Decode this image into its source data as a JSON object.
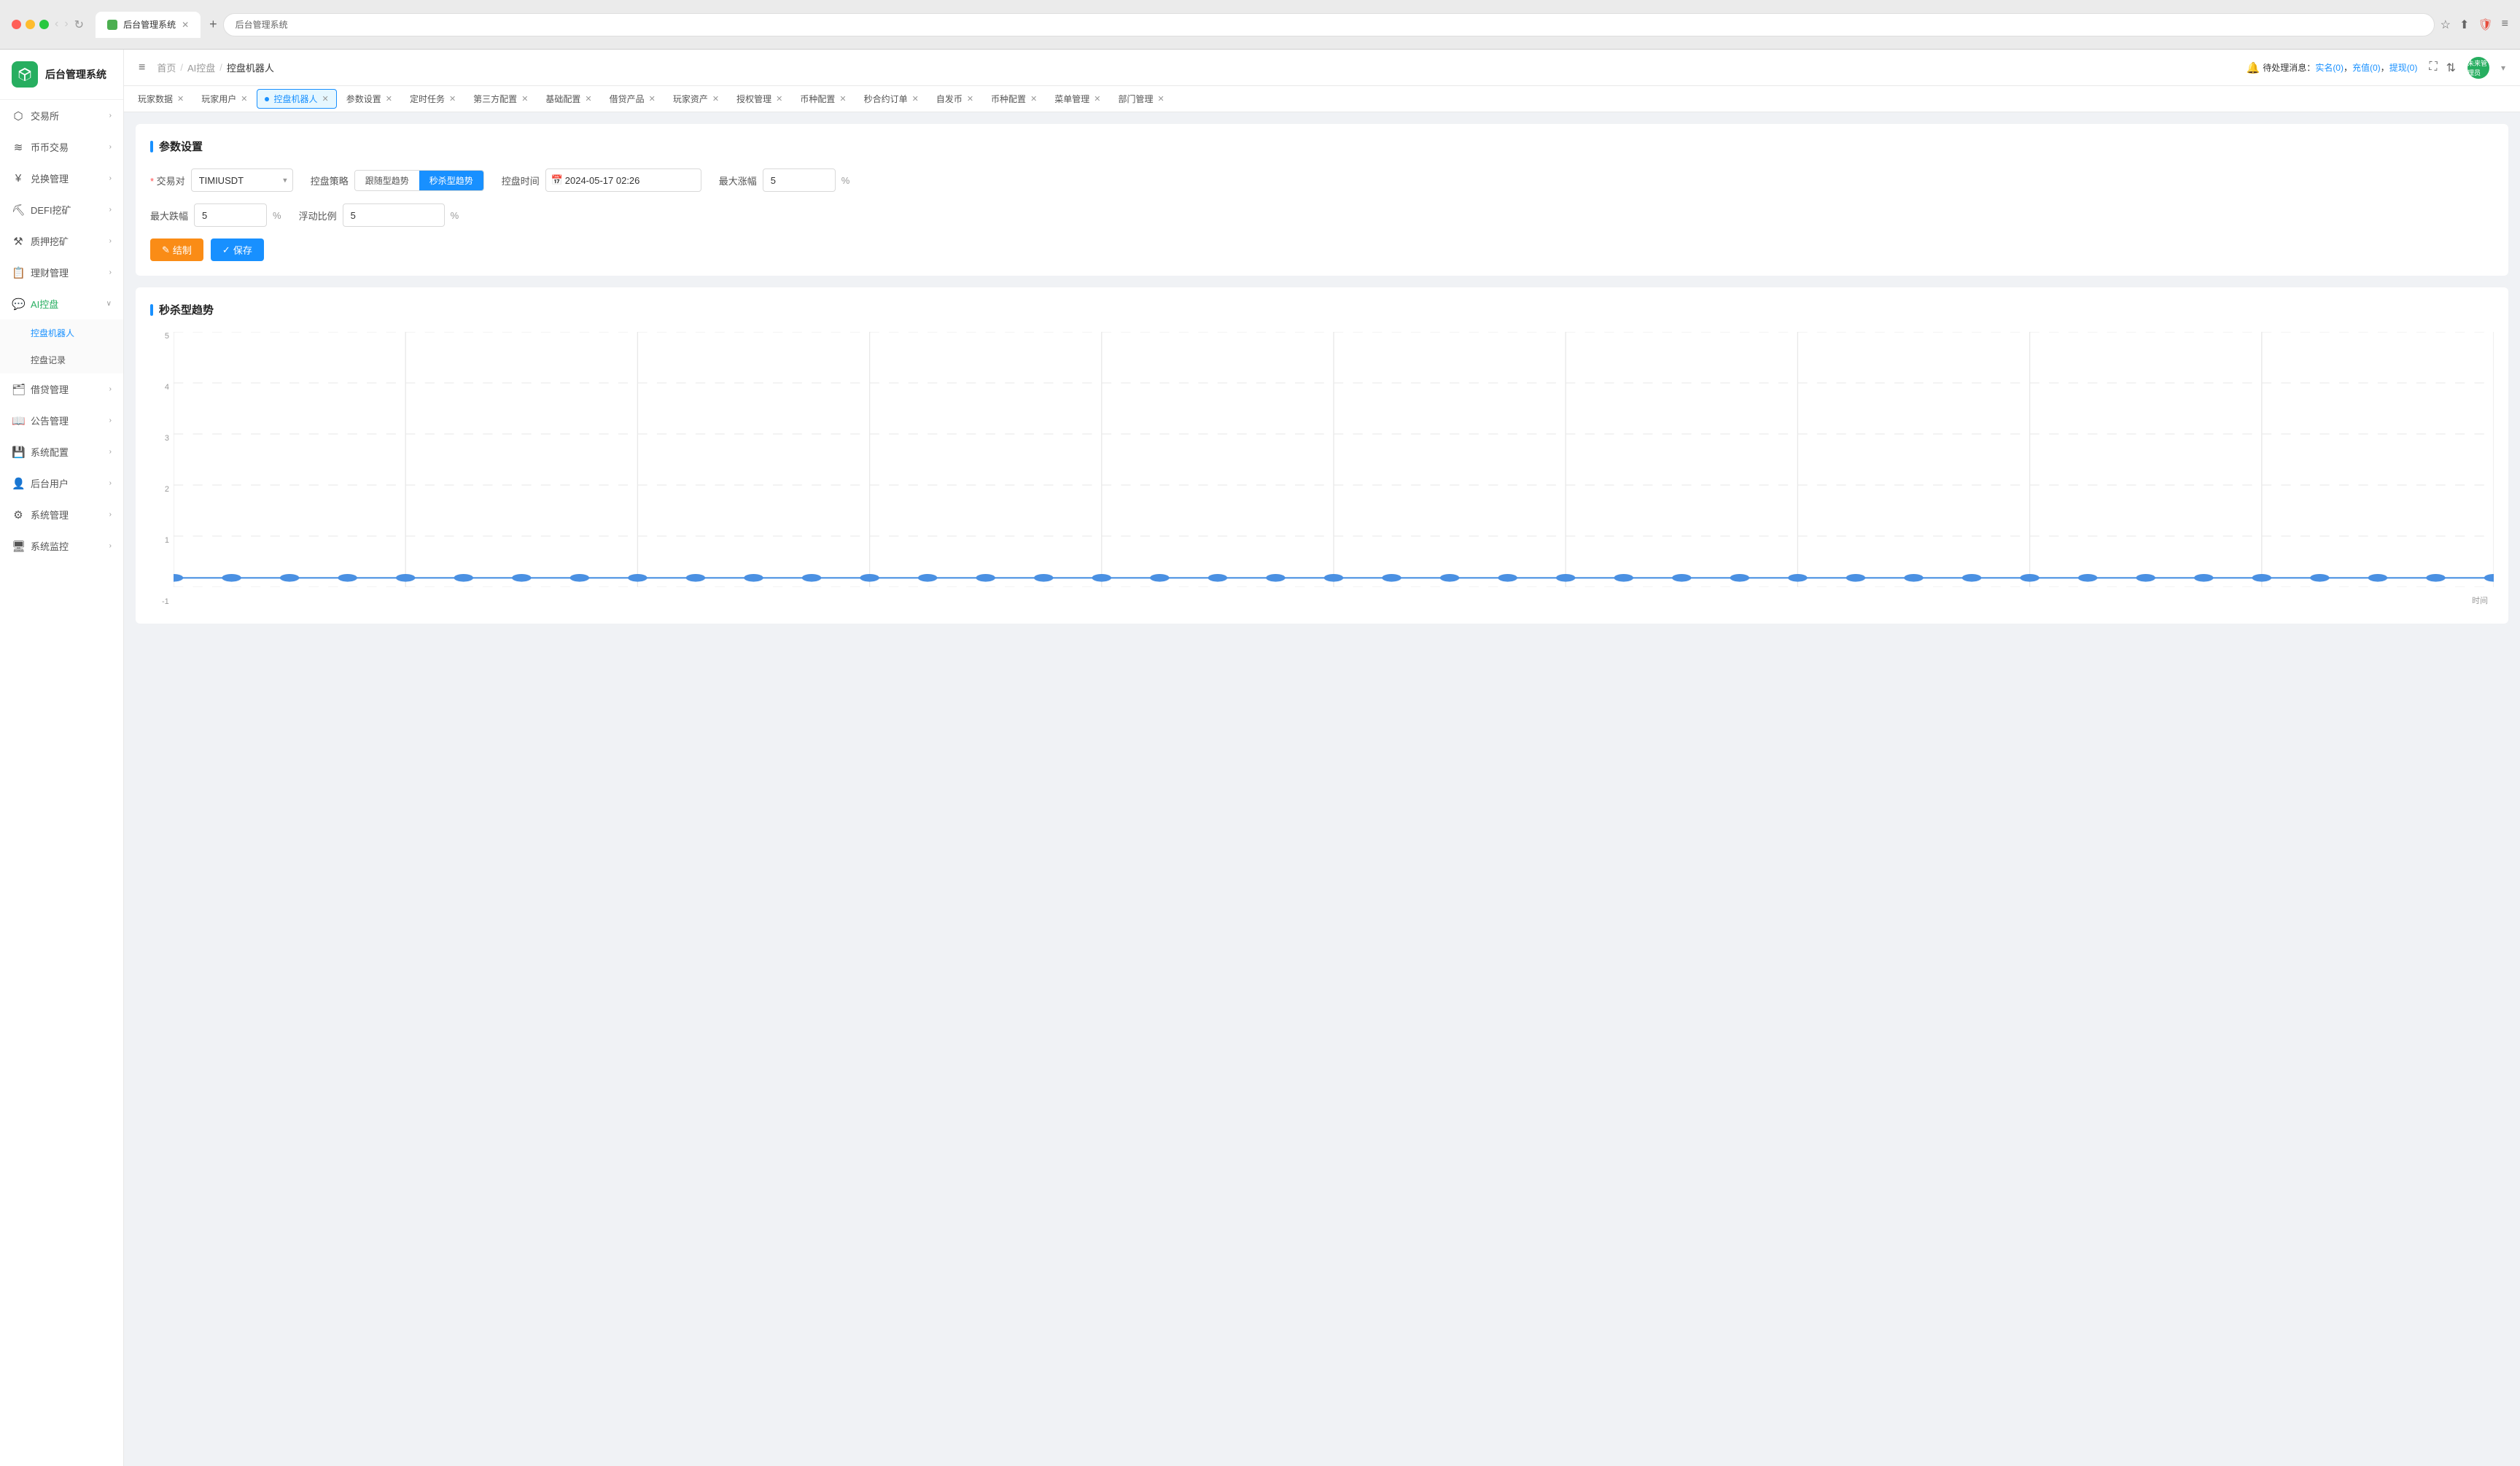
{
  "browser": {
    "tab_title": "后台管理系统",
    "url": "后台管理系统",
    "new_tab_label": "+"
  },
  "header": {
    "menu_toggle": "≡",
    "breadcrumbs": [
      "首页",
      "AI控盘",
      "控盘机器人"
    ],
    "notification": "待处理消息：实名(0)，充值(0)，提现(0)",
    "notification_realname": "实名(0)",
    "notification_recharge": "充值(0)",
    "notification_withdraw": "提现(0)",
    "user_label": "未来管理员"
  },
  "tabs": [
    {
      "label": "玩家数据",
      "closable": true,
      "active": false
    },
    {
      "label": "玩家用户",
      "closable": true,
      "active": false
    },
    {
      "label": "控盘机器人",
      "closable": true,
      "active": true
    },
    {
      "label": "参数设置",
      "closable": true,
      "active": false
    },
    {
      "label": "定时任务",
      "closable": true,
      "active": false
    },
    {
      "label": "第三方配置",
      "closable": true,
      "active": false
    },
    {
      "label": "基础配置",
      "closable": true,
      "active": false
    },
    {
      "label": "借贷产品",
      "closable": true,
      "active": false
    },
    {
      "label": "玩家资产",
      "closable": true,
      "active": false
    },
    {
      "label": "授权管理",
      "closable": true,
      "active": false
    },
    {
      "label": "币种配置",
      "closable": true,
      "active": false
    },
    {
      "label": "秒合约订单",
      "closable": true,
      "active": false
    },
    {
      "label": "自发币",
      "closable": true,
      "active": false
    },
    {
      "label": "币种配置",
      "closable": true,
      "active": false
    },
    {
      "label": "菜单管理",
      "closable": true,
      "active": false
    },
    {
      "label": "部门管理",
      "closable": true,
      "active": false
    }
  ],
  "sidebar": {
    "logo_text": "后台管理系统",
    "items": [
      {
        "id": "exchange",
        "label": "交易所",
        "icon": "🏦",
        "has_sub": true
      },
      {
        "id": "coin-trade",
        "label": "币币交易",
        "icon": "💱",
        "has_sub": true
      },
      {
        "id": "swap",
        "label": "兑换管理",
        "icon": "¥",
        "has_sub": true
      },
      {
        "id": "defi",
        "label": "DEFI挖矿",
        "icon": "⛏",
        "has_sub": true
      },
      {
        "id": "pledge",
        "label": "质押挖矿",
        "icon": "⚒",
        "has_sub": true
      },
      {
        "id": "finance",
        "label": "理财管理",
        "icon": "📋",
        "has_sub": true
      },
      {
        "id": "ai-control",
        "label": "AI控盘",
        "icon": "💬",
        "has_sub": true,
        "expanded": true
      },
      {
        "id": "loan",
        "label": "借贷管理",
        "icon": "🗂",
        "has_sub": true
      },
      {
        "id": "announcement",
        "label": "公告管理",
        "icon": "📖",
        "has_sub": true
      },
      {
        "id": "sys-config",
        "label": "系统配置",
        "icon": "💾",
        "has_sub": true
      },
      {
        "id": "backend-user",
        "label": "后台用户",
        "icon": "👤",
        "has_sub": true
      },
      {
        "id": "sys-manage",
        "label": "系统管理",
        "icon": "⚙",
        "has_sub": true
      },
      {
        "id": "sys-monitor",
        "label": "系统监控",
        "icon": "🖥",
        "has_sub": true
      }
    ],
    "ai_submenu": [
      {
        "id": "robot",
        "label": "控盘机器人",
        "active": true
      },
      {
        "id": "record",
        "label": "控盘记录",
        "active": false
      }
    ]
  },
  "params_section": {
    "title": "参数设置",
    "trading_pair_label": "交易对",
    "trading_pair_value": "TIMIUSDT",
    "strategy_label": "控盘策略",
    "strategy_options": [
      "跟随型趋势",
      "秒杀型趋势"
    ],
    "active_strategy": "秒杀型趋势",
    "control_time_label": "控盘时间",
    "control_time_value": "2024-05-17 02:26",
    "max_rise_label": "最大涨幅",
    "max_rise_value": "5",
    "max_rise_suffix": "%",
    "max_drop_label": "最大跌幅",
    "max_drop_value": "5",
    "max_drop_suffix": "%",
    "float_ratio_label": "浮动比例",
    "float_ratio_value": "5",
    "float_ratio_suffix": "%",
    "reset_btn": "结制",
    "save_btn": "保存"
  },
  "chart_section": {
    "title": "秒杀型趋势",
    "y_labels": [
      "5",
      "4",
      "3",
      "2",
      "1",
      ""
    ],
    "x_label": "时间",
    "data_value": 0,
    "line_color": "#4a90e2",
    "dot_color": "#4a90e2"
  }
}
